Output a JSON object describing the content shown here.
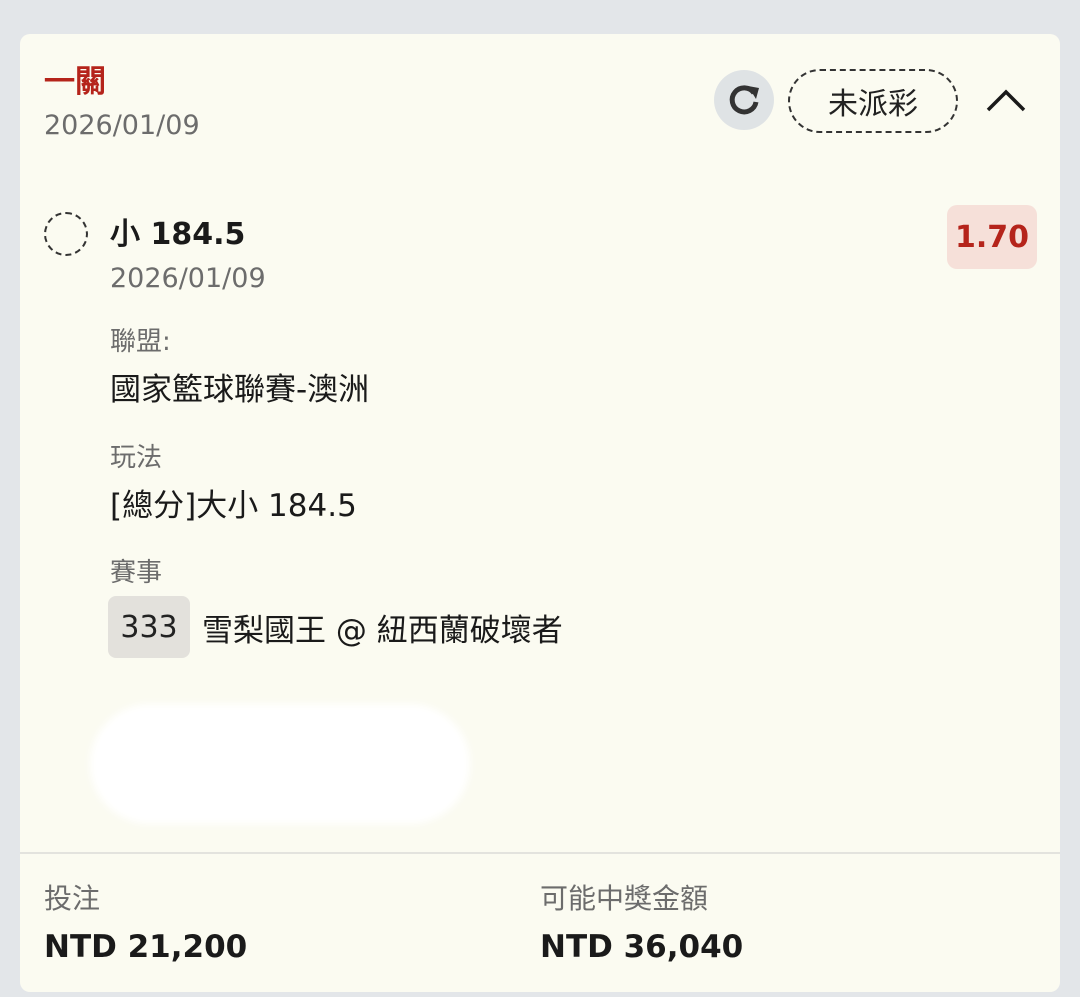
{
  "header": {
    "title": "一關",
    "date": "2026/01/09",
    "status_label": "未派彩",
    "refresh_icon": "refresh-icon",
    "collapse_icon": "chevron-up-icon"
  },
  "selection": {
    "name": "小 184.5",
    "date": "2026/01/09",
    "odds": "1.70",
    "league_label": "聯盟:",
    "league_value": "國家籃球聯賽-澳洲",
    "market_label": "玩法",
    "market_value": "[總分]大小 184.5",
    "event_label": "賽事",
    "event_id": "333",
    "event_name": "雪梨國王 @ 紐西蘭破壞者"
  },
  "footer": {
    "stake_label": "投注",
    "stake_value": "NTD 21,200",
    "payout_label": "可能中獎金額",
    "payout_value": "NTD 36,040"
  },
  "colors": {
    "accent_red": "#b5241b",
    "card_bg": "#fbfbf1",
    "page_bg": "#e3e6e9",
    "odds_bg": "#f6e0d9"
  }
}
